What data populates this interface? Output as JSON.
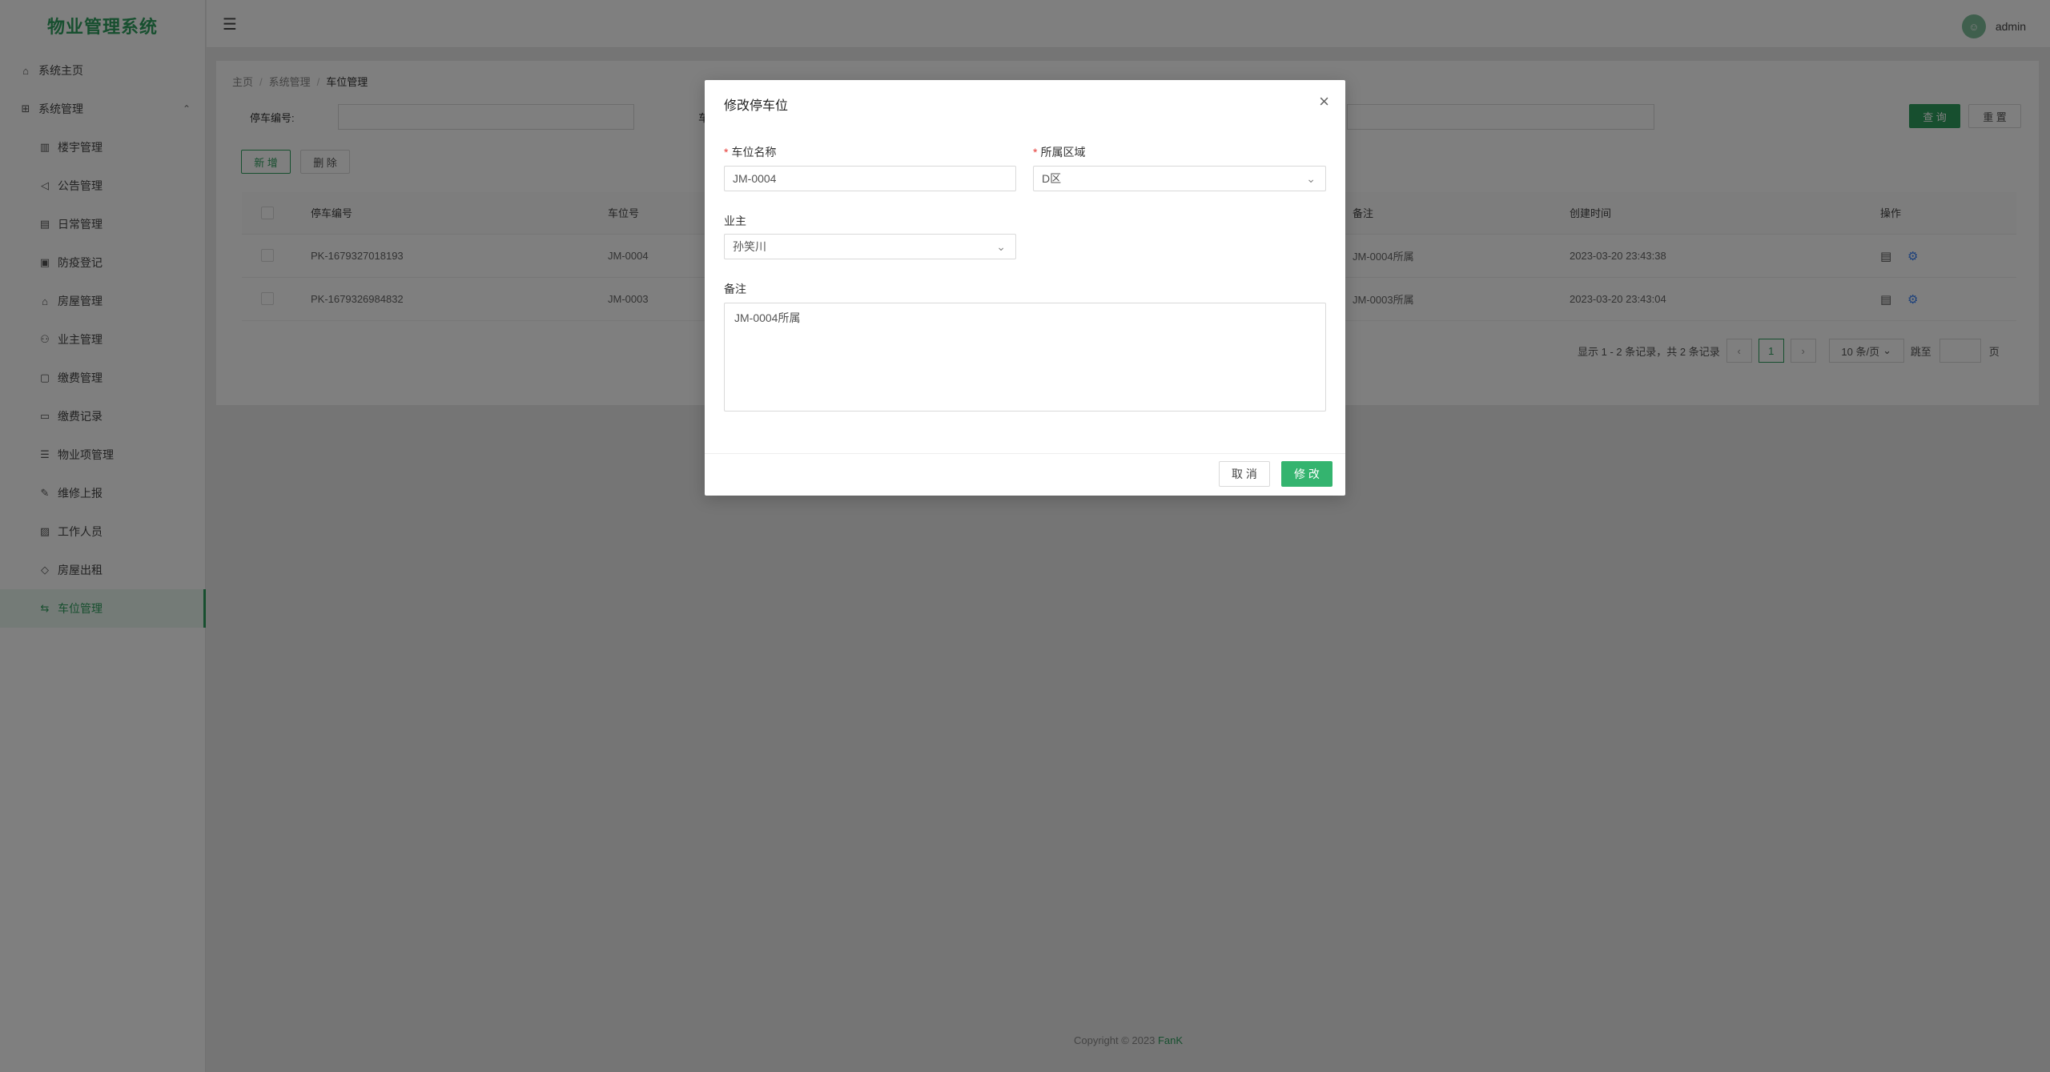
{
  "app": {
    "title": "物业管理系统"
  },
  "sidebar": {
    "items": [
      {
        "label": "系统主页",
        "icon": "home-icon"
      },
      {
        "label": "系统管理",
        "icon": "grid-icon"
      },
      {
        "label": "楼宇管理",
        "icon": "building-icon"
      },
      {
        "label": "公告管理",
        "icon": "megaphone-icon"
      },
      {
        "label": "日常管理",
        "icon": "calendar-icon"
      },
      {
        "label": "防疫登记",
        "icon": "shield-icon"
      },
      {
        "label": "房屋管理",
        "icon": "house-icon"
      },
      {
        "label": "业主管理",
        "icon": "users-icon"
      },
      {
        "label": "缴费管理",
        "icon": "payment-icon"
      },
      {
        "label": "缴费记录",
        "icon": "record-icon"
      },
      {
        "label": "物业项管理",
        "icon": "list-icon"
      },
      {
        "label": "维修上报",
        "icon": "wrench-icon"
      },
      {
        "label": "工作人员",
        "icon": "staff-icon"
      },
      {
        "label": "房屋出租",
        "icon": "tag-icon"
      },
      {
        "label": "车位管理",
        "icon": "parking-icon"
      }
    ]
  },
  "header": {
    "username": "admin"
  },
  "breadcrumb": {
    "home": "主页",
    "section": "系统管理",
    "current": "车位管理"
  },
  "search": {
    "parking_no_label": "停车编号:",
    "space_no_label": "车位号:",
    "query_label": "查 询",
    "reset_label": "重 置"
  },
  "toolbar": {
    "add_label": "新 增",
    "delete_label": "删 除"
  },
  "table": {
    "headers": {
      "parking_no": "停车编号",
      "space_no": "车位号",
      "remark": "备注",
      "created": "创建时间",
      "ops": "操作"
    },
    "rows": [
      {
        "parking_no": "PK-1679327018193",
        "space_no": "JM-0004",
        "remark": "JM-0004所属",
        "created": "2023-03-20 23:43:38"
      },
      {
        "parking_no": "PK-1679326984832",
        "space_no": "JM-0003",
        "remark": "JM-0003所属",
        "created": "2023-03-20 23:43:04"
      }
    ]
  },
  "pagination": {
    "summary": "显示 1 - 2 条记录，共 2 条记录",
    "current_page": "1",
    "page_size": "10 条/页",
    "jump_label": "跳至",
    "page_suffix": "页"
  },
  "footer": {
    "copyright": "Copyright © 2023",
    "author": "FanK"
  },
  "modal": {
    "title": "修改停车位",
    "space_name_label": "车位名称",
    "space_name_value": "JM-0004",
    "area_label": "所属区域",
    "area_value": "D区",
    "owner_label": "业主",
    "owner_value": "孙笑川",
    "remark_label": "备注",
    "remark_value": "JM-0004所属",
    "cancel_label": "取 消",
    "submit_label": "修 改"
  },
  "colors": {
    "accent": "#2f9e5e",
    "submit": "#34b46f",
    "required": "#e53935"
  }
}
